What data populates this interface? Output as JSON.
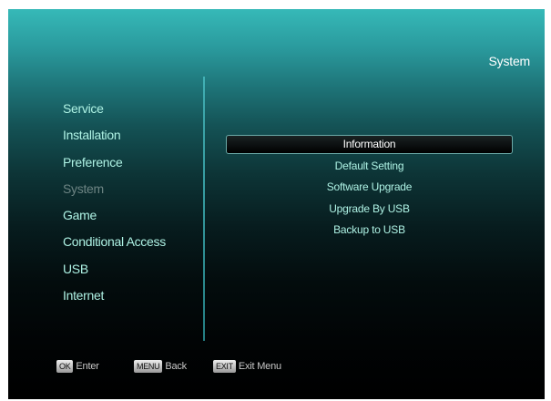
{
  "header": {
    "title": "System"
  },
  "left_menu": {
    "items": [
      {
        "label": "Service",
        "dimmed": false
      },
      {
        "label": "Installation",
        "dimmed": false
      },
      {
        "label": "Preference",
        "dimmed": false
      },
      {
        "label": "System",
        "dimmed": true
      },
      {
        "label": "Game",
        "dimmed": false
      },
      {
        "label": "Conditional Access",
        "dimmed": false
      },
      {
        "label": "USB",
        "dimmed": false
      },
      {
        "label": "Internet",
        "dimmed": false
      }
    ]
  },
  "sub_menu": {
    "selected_index": 0,
    "items": [
      {
        "label": "Information"
      },
      {
        "label": "Default Setting"
      },
      {
        "label": "Software Upgrade"
      },
      {
        "label": "Upgrade By USB"
      },
      {
        "label": "Backup to USB"
      }
    ]
  },
  "footer": {
    "hints": [
      {
        "key": "OK",
        "label": "Enter"
      },
      {
        "key": "MENU",
        "label": "Back"
      },
      {
        "key": "EXIT",
        "label": "Exit Menu"
      }
    ]
  },
  "colors": {
    "menu_text": "#aef2e4",
    "dimmed_text": "#6d8483",
    "selected_text": "#ffffff",
    "header_gradient_top": "#36b9b8",
    "background_bottom": "#000000"
  }
}
